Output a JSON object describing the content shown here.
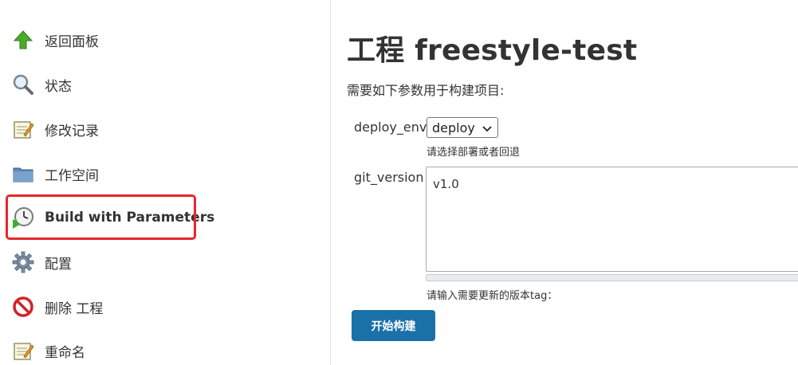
{
  "sidebar": {
    "items": [
      {
        "label": "返回面板",
        "icon": "up-arrow-icon"
      },
      {
        "label": "状态",
        "icon": "magnifier-icon"
      },
      {
        "label": "修改记录",
        "icon": "notepad-icon"
      },
      {
        "label": "工作空间",
        "icon": "folder-icon"
      },
      {
        "label": "Build with Parameters",
        "icon": "clock-play-icon"
      },
      {
        "label": "配置",
        "icon": "gear-icon"
      },
      {
        "label": "删除 工程",
        "icon": "no-entry-icon"
      },
      {
        "label": "重命名",
        "icon": "notepad-icon"
      }
    ],
    "highlight_color": "#e8262d"
  },
  "main": {
    "title": "工程 freestyle-test",
    "description": "需要如下参数用于构建项目:",
    "params": [
      {
        "name": "deploy_env",
        "selected": "deploy",
        "hint": "请选择部署或者回退"
      },
      {
        "name": "git_version",
        "value": "v1.0",
        "hint": "请输入需要更新的版本tag："
      }
    ],
    "build_button": "开始构建",
    "button_color": "#1a71a8"
  }
}
